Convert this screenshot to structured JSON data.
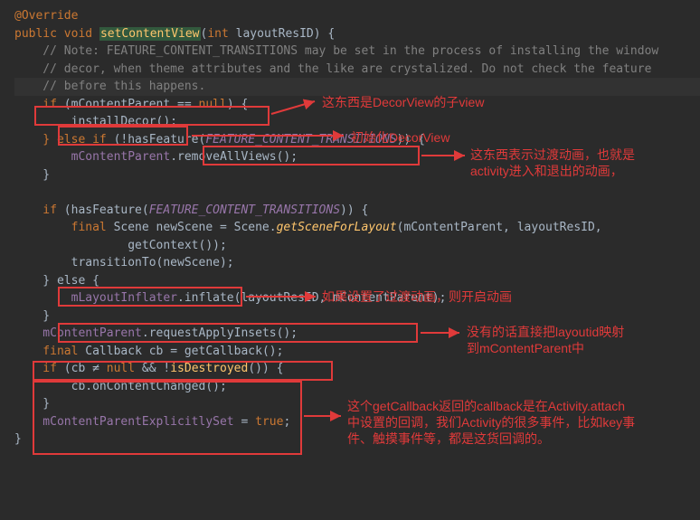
{
  "code": {
    "l1": "@Override",
    "l2_public": "public",
    "l2_void": "void",
    "l2_name": "setContentView",
    "l2_int": "int",
    "l2_param": "layoutResID) {",
    "l3": "    // Note: FEATURE_CONTENT_TRANSITIONS may be set in the process of installing the window",
    "l4": "    // decor, when theme attributes and the like are crystalized. Do not check the feature",
    "l5": "    // before this happens.",
    "l6_if": "    if",
    "l6_cond": " (mContentParent == ",
    "l6_null": "null",
    "l6_end": ") {",
    "l7": "        installDecor();",
    "l8_else": "    } else if",
    "l8_mid": " (!hasFeature(",
    "l8_const": "FEATURE_CONTENT_TRANSITIONS",
    "l8_end": ")) {",
    "l9_field": "        mContentParent",
    "l9_call": ".removeAllViews();",
    "l10": "    }",
    "l12_if": "    if",
    "l12_mid": " (hasFeature(",
    "l12_const": "FEATURE_CONTENT_TRANSITIONS",
    "l12_end": ")) {",
    "l13_final": "        final",
    "l13_mid1": " Scene newScene = Scene.",
    "l13_static": "getSceneForLayout",
    "l13_mid2": "(mContentParent, layoutResID,",
    "l14": "                getContext());",
    "l15": "        transitionTo(newScene);",
    "l16": "    } else {",
    "l17_field": "        mLayoutInflater",
    "l17_mid": ".inflate(layoutResID, mContentParent);",
    "l18": "    }",
    "l19_field": "    mContentParent",
    "l19_call": ".requestApplyInsets();",
    "l20_final": "    final",
    "l20_rest": " Callback cb = getCallback();",
    "l21_if": "    if",
    "l21_mid1": " (cb ≠ ",
    "l21_null": "null",
    "l21_mid2": " && !",
    "l21_call": "isDestroyed",
    "l21_end": "()) {",
    "l22": "        cb.onContentChanged();",
    "l23": "    }",
    "l24_field": "    mContentParentExplicitlySet",
    "l24_rest": " = ",
    "l24_true": "true",
    "l24_semi": ";",
    "l25": "}"
  },
  "annotations": {
    "a1": "这东西是DecorView的子view",
    "a2": "初始化DecorView",
    "a3_l1": "这东西表示过渡动画，也就是",
    "a3_l2": "activity进入和退出的动画，",
    "a4": "如果设置了过渡动画，则开启动画",
    "a5_l1": "没有的话直接把layoutid映射",
    "a5_l2": "到mContentParent中",
    "a6_l1": "这个getCallback返回的callback是在Activity.attach",
    "a6_l2": "中设置的回调，我们Activity的很多事件，比如key事",
    "a6_l3": "件、触摸事件等，都是这货回调的。"
  }
}
